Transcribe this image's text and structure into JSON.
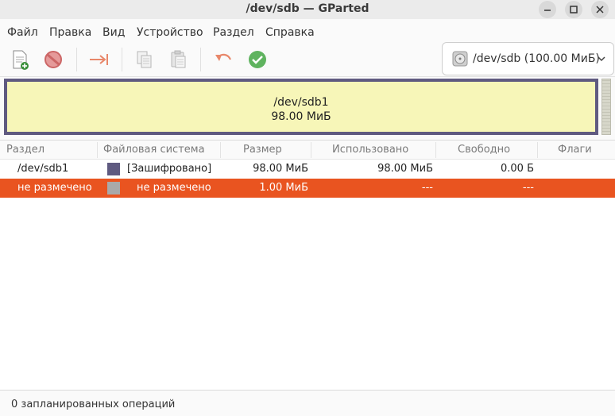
{
  "window": {
    "title": "/dev/sdb — GParted"
  },
  "menu": {
    "items": [
      "Файл",
      "Правка",
      "Вид",
      "Устройство",
      "Раздел",
      "Справка"
    ]
  },
  "toolbar": {
    "buttons": [
      "new-partition-icon",
      "delete-partition-icon",
      "resize-move-icon",
      "copy-icon",
      "paste-icon",
      "undo-icon",
      "apply-icon"
    ]
  },
  "device": {
    "selected": "/dev/sdb (100.00 МиБ)"
  },
  "diskmap": {
    "partition_name": "/dev/sdb1",
    "partition_size": "98.00 МиБ"
  },
  "table": {
    "columns": [
      "Раздел",
      "Файловая система",
      "Размер",
      "Использовано",
      "Свободно",
      "Флаги"
    ],
    "rows": [
      {
        "partition": "/dev/sdb1",
        "filesystem": "[Зашифровано]",
        "fs_color": "#5f5a80",
        "size": "98.00 МиБ",
        "used": "98.00 МиБ",
        "free": "0.00 Б",
        "flags": ""
      },
      {
        "partition": "не размечено",
        "filesystem": "не размечено",
        "fs_color": "#a9a9a9",
        "size": "1.00 МиБ",
        "used": "---",
        "free": "---",
        "flags": ""
      }
    ]
  },
  "colors": {
    "selection": "#e95420",
    "partition_fill": "#f7f6b8",
    "partition_border": "#5f5a80"
  },
  "status": {
    "text": "0 запланированных операций"
  }
}
